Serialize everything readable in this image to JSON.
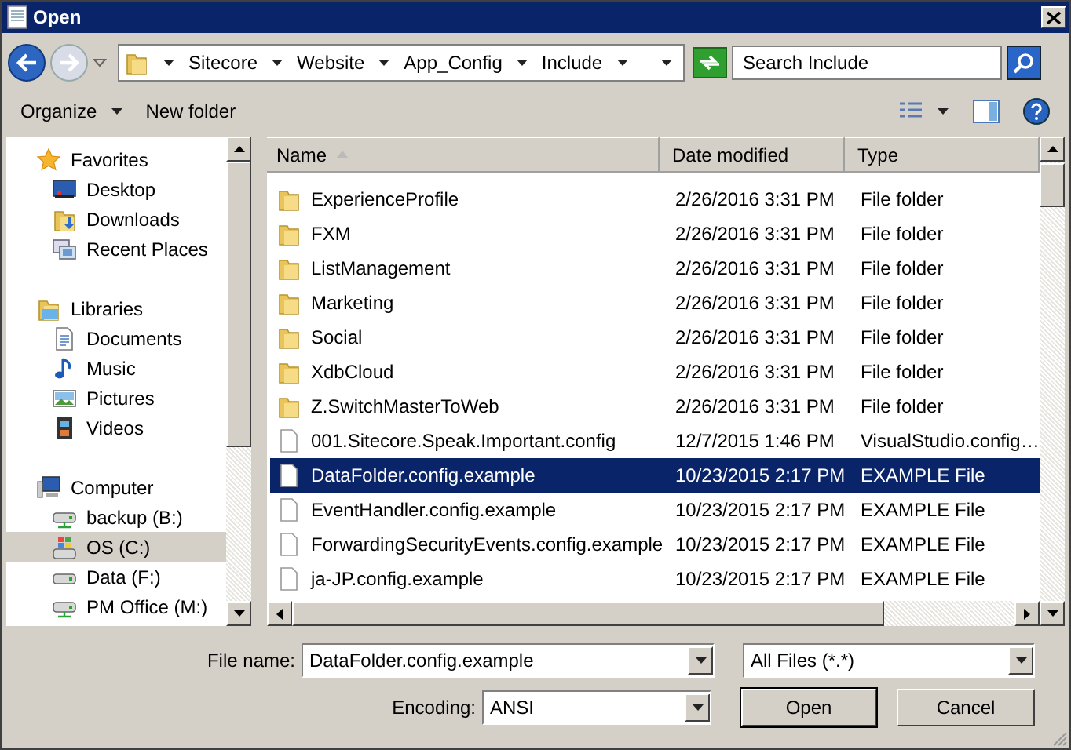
{
  "window": {
    "title": "Open"
  },
  "address": {
    "crumbs": [
      "Sitecore",
      "Website",
      "App_Config",
      "Include"
    ],
    "search_placeholder": "Search Include"
  },
  "toolbar": [
    {
      "label": "Organize",
      "dropdown": true
    },
    {
      "label": "New folder",
      "dropdown": false
    }
  ],
  "sidebar": [
    {
      "label": "Favorites",
      "kind": "star",
      "items": [
        {
          "label": "Desktop",
          "kind": "desktop",
          "selected": false
        },
        {
          "label": "Downloads",
          "kind": "downloads",
          "selected": false
        },
        {
          "label": "Recent Places",
          "kind": "recent",
          "selected": false
        }
      ]
    },
    {
      "label": "Libraries",
      "kind": "library",
      "items": [
        {
          "label": "Documents",
          "kind": "documents",
          "selected": false
        },
        {
          "label": "Music",
          "kind": "music",
          "selected": false
        },
        {
          "label": "Pictures",
          "kind": "pictures",
          "selected": false
        },
        {
          "label": "Videos",
          "kind": "videos",
          "selected": false
        }
      ]
    },
    {
      "label": "Computer",
      "kind": "computer",
      "items": [
        {
          "label": "backup (B:)",
          "kind": "netdrive",
          "selected": false
        },
        {
          "label": "OS (C:)",
          "kind": "osdrive",
          "selected": true
        },
        {
          "label": "Data (F:)",
          "kind": "drive",
          "selected": false
        },
        {
          "label": "PM Office (M:)",
          "kind": "netdrive",
          "selected": false
        }
      ]
    }
  ],
  "columns": [
    {
      "label": "Name",
      "sorted": true
    },
    {
      "label": "Date modified",
      "sorted": false
    },
    {
      "label": "Type",
      "sorted": false
    }
  ],
  "rows": [
    {
      "name": "ExperienceProfile",
      "date": "2/26/2016 3:31 PM",
      "type": "File folder",
      "kind": "folder",
      "selected": false
    },
    {
      "name": "FXM",
      "date": "2/26/2016 3:31 PM",
      "type": "File folder",
      "kind": "folder",
      "selected": false
    },
    {
      "name": "ListManagement",
      "date": "2/26/2016 3:31 PM",
      "type": "File folder",
      "kind": "folder",
      "selected": false
    },
    {
      "name": "Marketing",
      "date": "2/26/2016 3:31 PM",
      "type": "File folder",
      "kind": "folder",
      "selected": false
    },
    {
      "name": "Social",
      "date": "2/26/2016 3:31 PM",
      "type": "File folder",
      "kind": "folder",
      "selected": false
    },
    {
      "name": "XdbCloud",
      "date": "2/26/2016 3:31 PM",
      "type": "File folder",
      "kind": "folder",
      "selected": false
    },
    {
      "name": "Z.SwitchMasterToWeb",
      "date": "2/26/2016 3:31 PM",
      "type": "File folder",
      "kind": "folder",
      "selected": false
    },
    {
      "name": "001.Sitecore.Speak.Important.config",
      "date": "12/7/2015 1:46 PM",
      "type": "VisualStudio.config…",
      "kind": "file",
      "selected": false
    },
    {
      "name": "DataFolder.config.example",
      "date": "10/23/2015 2:17 PM",
      "type": "EXAMPLE File",
      "kind": "file",
      "selected": true
    },
    {
      "name": "EventHandler.config.example",
      "date": "10/23/2015 2:17 PM",
      "type": "EXAMPLE File",
      "kind": "file",
      "selected": false
    },
    {
      "name": "ForwardingSecurityEvents.config.example",
      "date": "10/23/2015 2:17 PM",
      "type": "EXAMPLE File",
      "kind": "file",
      "selected": false
    },
    {
      "name": "ja-JP.config.example",
      "date": "10/23/2015 2:17 PM",
      "type": "EXAMPLE File",
      "kind": "file",
      "selected": false
    }
  ],
  "file_name": {
    "label": "File name:",
    "value": "DataFolder.config.example"
  },
  "filter": {
    "value": "All Files  (*.*)"
  },
  "encoding": {
    "label": "Encoding:",
    "value": "ANSI"
  },
  "buttons": [
    {
      "label": "Open",
      "default": true
    },
    {
      "label": "Cancel",
      "default": false
    }
  ]
}
